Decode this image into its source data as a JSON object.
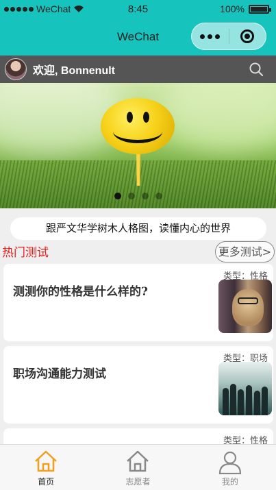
{
  "status_bar": {
    "carrier": "WeChat",
    "time": "8:45",
    "battery": "100%"
  },
  "nav": {
    "title": "WeChat"
  },
  "welcome": {
    "text": "欢迎, Bonnenult"
  },
  "banner": {
    "page_count": 4,
    "active_page": 1
  },
  "slogan": "跟严文华学树木人格图，读懂内心的世界",
  "section": {
    "title": "热门测试",
    "more_label": "更多测试>"
  },
  "tests": [
    {
      "title": "测测你的性格是什么样的?",
      "type": "类型：性格"
    },
    {
      "title": "职场沟通能力测试",
      "type": "类型：职场"
    },
    {
      "title": "",
      "type": "类型：性格"
    }
  ],
  "tabbar": [
    {
      "label": "首页",
      "icon": "home-icon",
      "active": true
    },
    {
      "label": "志愿者",
      "icon": "home-icon",
      "active": false
    },
    {
      "label": "我的",
      "icon": "user-icon",
      "active": false
    }
  ],
  "colors": {
    "nav_bg": "#17c3bd",
    "accent_active": "#f0a020",
    "hot_title": "#e41c1c"
  }
}
